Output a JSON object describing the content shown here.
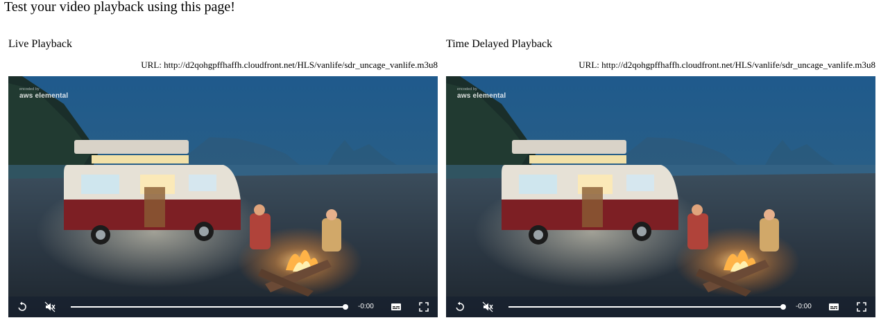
{
  "page": {
    "heading": "Test your video playback using this page!"
  },
  "players": [
    {
      "title": "Live Playback",
      "url_text": "URL: http://d2qohgpffhaffh.cloudfront.net/HLS/vanlife/sdr_uncage_vanlife.m3u8",
      "watermark_small": "encoded by",
      "watermark_brand": "aws elemental",
      "time_remaining": "-0:00",
      "progress": 1.0,
      "icons": {
        "replay": "replay-icon",
        "mute": "volume-muted-icon",
        "captions": "captions-icon",
        "fullscreen": "fullscreen-icon"
      }
    },
    {
      "title": "Time Delayed Playback",
      "url_text": "URL: http://d2qohgpffhaffh.cloudfront.net/HLS/vanlife/sdr_uncage_vanlife.m3u8",
      "watermark_small": "encoded by",
      "watermark_brand": "aws elemental",
      "time_remaining": "-0:00",
      "progress": 1.0,
      "icons": {
        "replay": "replay-icon",
        "mute": "volume-muted-icon",
        "captions": "captions-icon",
        "fullscreen": "fullscreen-icon"
      }
    }
  ]
}
